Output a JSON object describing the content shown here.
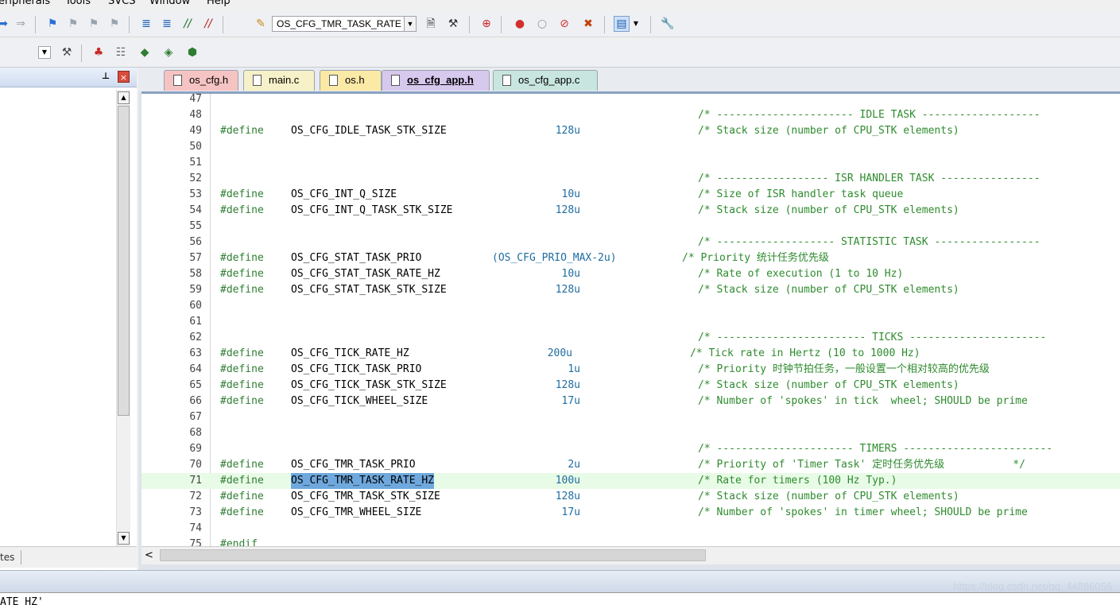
{
  "menubar": {
    "items": [
      "eripherals",
      "Tools",
      "SVCS",
      "Window",
      "Help"
    ]
  },
  "toolbar": {
    "target_combo": "OS_CFG_TMR_TASK_RATE"
  },
  "left_panel": {
    "bottom_tab": "tes"
  },
  "tabs": [
    {
      "label": "os_cfg.h",
      "color": "#f6c3c3"
    },
    {
      "label": "main.c",
      "color": "#f6f1c8"
    },
    {
      "label": "os.h",
      "color": "#fbe9a6"
    },
    {
      "label": "os_cfg_app.h",
      "color": "#d7c8ee",
      "active": true
    },
    {
      "label": "os_cfg_app.c",
      "color": "#c8e6df"
    }
  ],
  "code": [
    {
      "ln": "47"
    },
    {
      "ln": "48",
      "cmt": "/* ---------------------- IDLE TASK -------------------"
    },
    {
      "ln": "49",
      "kw": "#define",
      "mac": "OS_CFG_IDLE_TASK_STK_SIZE",
      "val": "128u",
      "cmt": "/* Stack size (number of CPU_STK elements)"
    },
    {
      "ln": "50"
    },
    {
      "ln": "51"
    },
    {
      "ln": "52",
      "cmt": "/* ------------------ ISR HANDLER TASK ----------------"
    },
    {
      "ln": "53",
      "kw": "#define",
      "mac": "OS_CFG_INT_Q_SIZE",
      "val": "10u",
      "cmt": "/* Size of ISR handler task queue"
    },
    {
      "ln": "54",
      "kw": "#define",
      "mac": "OS_CFG_INT_Q_TASK_STK_SIZE",
      "val": "128u",
      "cmt": "/* Stack size (number of CPU_STK elements)"
    },
    {
      "ln": "55"
    },
    {
      "ln": "56",
      "cmt": "/* ------------------- STATISTIC TASK -----------------"
    },
    {
      "ln": "57",
      "kw": "#define",
      "mac": "OS_CFG_STAT_TASK_PRIO",
      "val": "(OS_CFG_PRIO_MAX-2u)",
      "cmt": "/* Priority 统计任务优先级"
    },
    {
      "ln": "58",
      "kw": "#define",
      "mac": "OS_CFG_STAT_TASK_RATE_HZ",
      "val": "10u",
      "cmt": "/* Rate of execution (1 to 10 Hz)"
    },
    {
      "ln": "59",
      "kw": "#define",
      "mac": "OS_CFG_STAT_TASK_STK_SIZE",
      "val": "128u",
      "cmt": "/* Stack size (number of CPU_STK elements)"
    },
    {
      "ln": "60"
    },
    {
      "ln": "61"
    },
    {
      "ln": "62",
      "cmt": "/* ------------------------ TICKS ----------------------"
    },
    {
      "ln": "63",
      "kw": "#define",
      "mac": "OS_CFG_TICK_RATE_HZ",
      "val": "200u",
      "cmt": "/* Tick rate in Hertz (10 to 1000 Hz)"
    },
    {
      "ln": "64",
      "kw": "#define",
      "mac": "OS_CFG_TICK_TASK_PRIO",
      "val": "1u",
      "cmt": "/* Priority 时钟节拍任务，一般设置一个相对较高的优先级"
    },
    {
      "ln": "65",
      "kw": "#define",
      "mac": "OS_CFG_TICK_TASK_STK_SIZE",
      "val": "128u",
      "cmt": "/* Stack size (number of CPU_STK elements)"
    },
    {
      "ln": "66",
      "kw": "#define",
      "mac": "OS_CFG_TICK_WHEEL_SIZE",
      "val": "17u",
      "cmt": "/* Number of 'spokes' in tick  wheel; SHOULD be prime"
    },
    {
      "ln": "67"
    },
    {
      "ln": "68"
    },
    {
      "ln": "69",
      "cmt": "/* ---------------------- TIMERS ------------------------"
    },
    {
      "ln": "70",
      "kw": "#define",
      "mac": "OS_CFG_TMR_TASK_PRIO",
      "val": "2u",
      "cmt": "/* Priority of 'Timer Task' 定时任务优先级           */"
    },
    {
      "ln": "71",
      "kw": "#define",
      "mac": "OS_CFG_TMR_TASK_RATE_HZ",
      "val": "100u",
      "cmt": "/* Rate for timers (100 Hz Typ.)",
      "current": true,
      "selected": true
    },
    {
      "ln": "72",
      "kw": "#define",
      "mac": "OS_CFG_TMR_TASK_STK_SIZE",
      "val": "128u",
      "cmt": "/* Stack size (number of CPU_STK elements)"
    },
    {
      "ln": "73",
      "kw": "#define",
      "mac": "OS_CFG_TMR_WHEEL_SIZE",
      "val": "17u",
      "cmt": "/* Number of 'spokes' in timer wheel; SHOULD be prime"
    },
    {
      "ln": "74"
    },
    {
      "ln": "75",
      "kw": "#endif"
    }
  ],
  "bottom_text": "ATE_HZ'",
  "watermark": "https://blog.csdn.net/qq_44886056"
}
